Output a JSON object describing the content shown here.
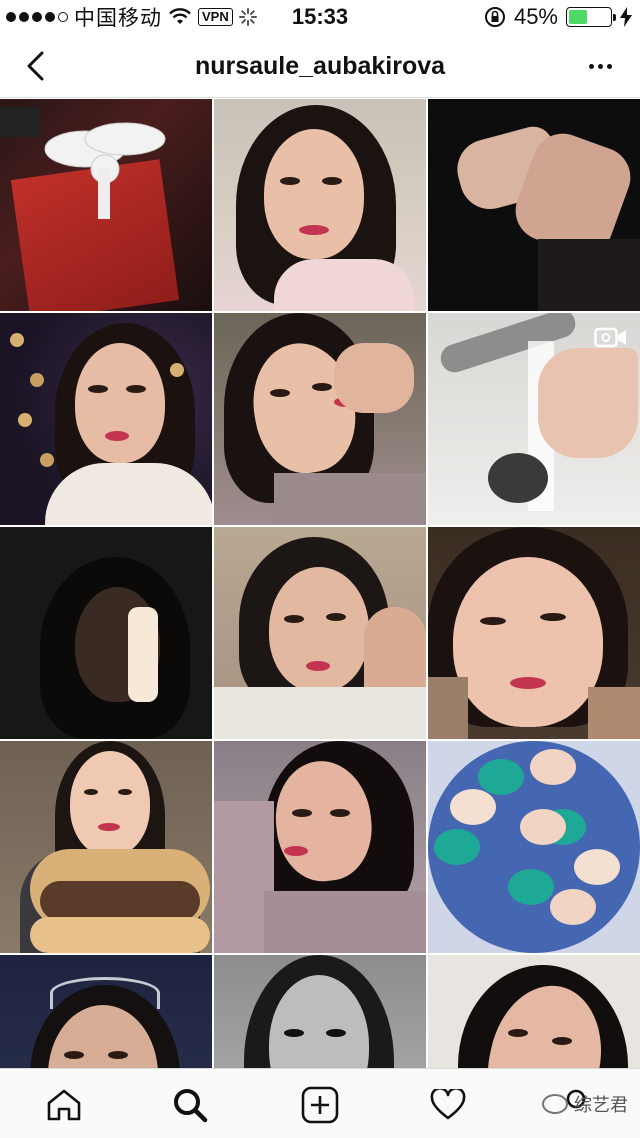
{
  "status_bar": {
    "carrier": "中国移动",
    "vpn": "VPN",
    "time": "15:33",
    "battery": "45%",
    "battery_level": 0.45,
    "battery_color": "#4cd964"
  },
  "header": {
    "title": "nursaule_aubakirova",
    "back_icon": "chevron-left-icon",
    "more_icon": "ellipsis-horizontal-icon"
  },
  "grid": {
    "columns": 3,
    "video_badge_tile_index": 5,
    "video_badge_icon": "video-camera-icon"
  },
  "tab_bar": {
    "tabs": [
      "home-icon",
      "search-icon",
      "add-post-icon",
      "heart-icon",
      "profile-icon"
    ],
    "active_tab": "search-icon"
  },
  "watermark": {
    "text": "综艺君"
  }
}
